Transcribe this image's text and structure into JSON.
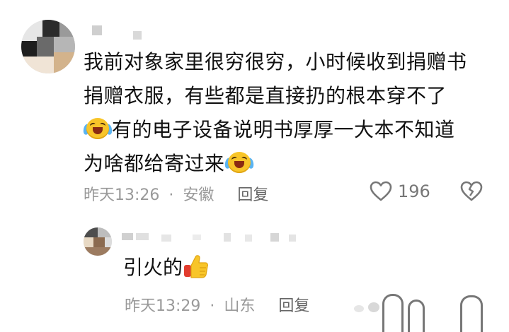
{
  "comment": {
    "lines": [
      "我前对象家里很穷很穷，小时候收到捐赠书",
      "捐赠衣服，有些都是直接扔的根本穿不了",
      "有的电子设备说明书厚厚一大本不知道",
      "为啥都给寄过来"
    ],
    "emoji_1": "laughing-with-tears-emoji",
    "emoji_2": "laughing-with-tears-emoji",
    "time": "昨天13:26",
    "separator": "·",
    "location": "安徽",
    "reply_label": "回复",
    "like_count": "196"
  },
  "reply": {
    "text": "引火的",
    "emoji": "thumbs-up-emoji",
    "time": "昨天13:29",
    "separator": "·",
    "location": "山东",
    "reply_label": "回复"
  },
  "icons": {
    "like": "heart-outline-icon",
    "dislike": "broken-heart-icon"
  },
  "colors": {
    "text_primary": "#111111",
    "text_meta": "#999999",
    "icon_gray": "#777777",
    "emoji_yellow": "#f8c529",
    "tear_blue": "#5bb4f2"
  }
}
